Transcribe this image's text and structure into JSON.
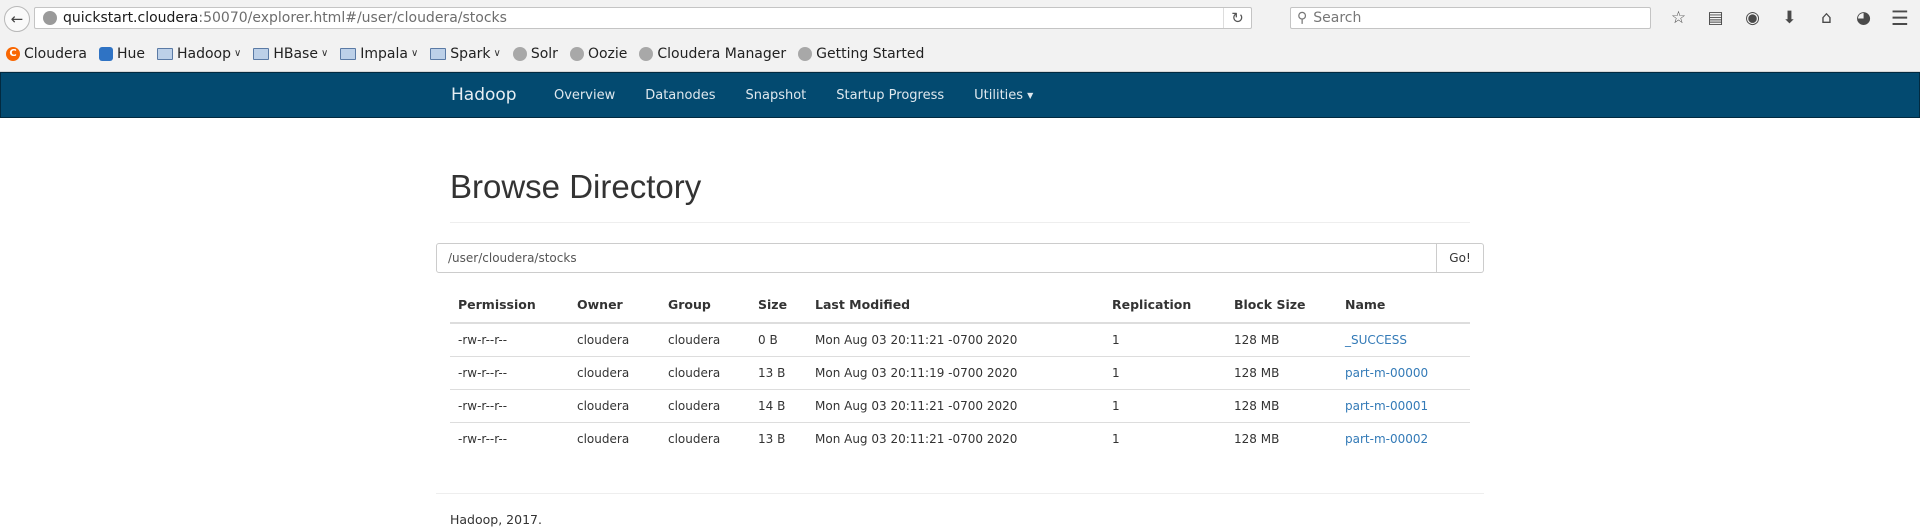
{
  "browser": {
    "url_host": "quickstart.cloudera",
    "url_rest": ":50070/explorer.html#/user/cloudera/stocks",
    "search_placeholder": "Search",
    "bookmarks": [
      {
        "label": "Cloudera",
        "icon": "cloudera-icon",
        "dropdown": false
      },
      {
        "label": "Hue",
        "icon": "hue-icon",
        "dropdown": false
      },
      {
        "label": "Hadoop",
        "icon": "folder-icon",
        "dropdown": true
      },
      {
        "label": "HBase",
        "icon": "folder-icon",
        "dropdown": true
      },
      {
        "label": "Impala",
        "icon": "folder-icon",
        "dropdown": true
      },
      {
        "label": "Spark",
        "icon": "folder-icon",
        "dropdown": true
      },
      {
        "label": "Solr",
        "icon": "globe-icon",
        "dropdown": false
      },
      {
        "label": "Oozie",
        "icon": "globe-icon",
        "dropdown": false
      },
      {
        "label": "Cloudera Manager",
        "icon": "globe-icon",
        "dropdown": false
      },
      {
        "label": "Getting Started",
        "icon": "globe-icon",
        "dropdown": false
      }
    ]
  },
  "navbar": {
    "brand": "Hadoop",
    "items": [
      "Overview",
      "Datanodes",
      "Snapshot",
      "Startup Progress",
      "Utilities"
    ],
    "color": "#034a70"
  },
  "main": {
    "title": "Browse Directory",
    "path_value": "/user/cloudera/stocks",
    "go_label": "Go!",
    "columns": [
      "Permission",
      "Owner",
      "Group",
      "Size",
      "Last Modified",
      "Replication",
      "Block Size",
      "Name"
    ],
    "rows": [
      {
        "permission": "-rw-r--r--",
        "owner": "cloudera",
        "group": "cloudera",
        "size": "0 B",
        "modified": "Mon Aug 03 20:11:21 -0700 2020",
        "replication": "1",
        "block_size": "128 MB",
        "name": "_SUCCESS"
      },
      {
        "permission": "-rw-r--r--",
        "owner": "cloudera",
        "group": "cloudera",
        "size": "13 B",
        "modified": "Mon Aug 03 20:11:19 -0700 2020",
        "replication": "1",
        "block_size": "128 MB",
        "name": "part-m-00000"
      },
      {
        "permission": "-rw-r--r--",
        "owner": "cloudera",
        "group": "cloudera",
        "size": "14 B",
        "modified": "Mon Aug 03 20:11:21 -0700 2020",
        "replication": "1",
        "block_size": "128 MB",
        "name": "part-m-00001"
      },
      {
        "permission": "-rw-r--r--",
        "owner": "cloudera",
        "group": "cloudera",
        "size": "13 B",
        "modified": "Mon Aug 03 20:11:21 -0700 2020",
        "replication": "1",
        "block_size": "128 MB",
        "name": "part-m-00002"
      }
    ],
    "footer": "Hadoop, 2017."
  }
}
